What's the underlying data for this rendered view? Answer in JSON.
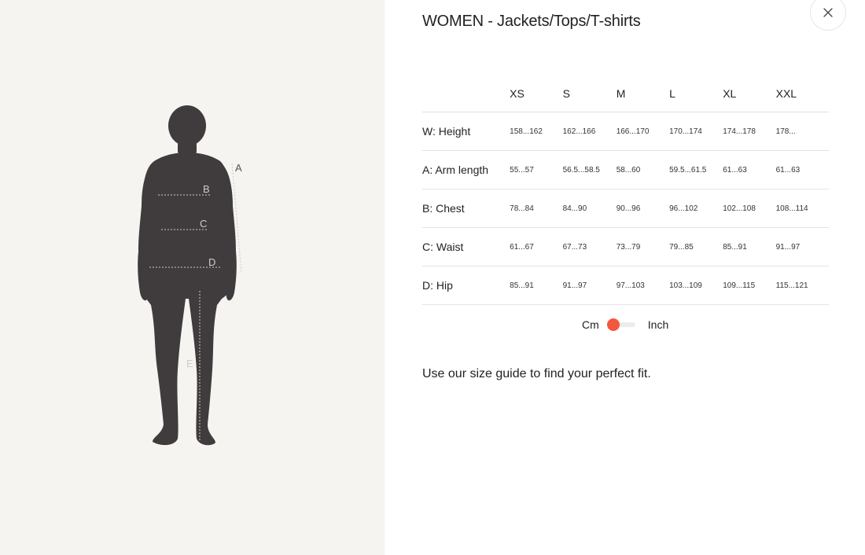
{
  "figure": {
    "labels": {
      "a": "A",
      "b": "B",
      "c": "C",
      "d": "D",
      "e": "E"
    },
    "silhouette_color": "#403b3c",
    "background_color": "#f5f4f0"
  },
  "header": {
    "title": "WOMEN - Jackets/Tops/T-shirts",
    "close_icon": "×"
  },
  "table": {
    "sizes": [
      "XS",
      "S",
      "M",
      "L",
      "XL",
      "XXL"
    ],
    "rows": [
      {
        "label": "W: Height",
        "values": [
          "158...162",
          "162...166",
          "166...170",
          "170...174",
          "174...178",
          "178..."
        ]
      },
      {
        "label": "A: Arm length",
        "values": [
          "55...57",
          "56.5...58.5",
          "58...60",
          "59.5...61.5",
          "61...63",
          "61...63"
        ]
      },
      {
        "label": "B: Chest",
        "values": [
          "78...84",
          "84...90",
          "90...96",
          "96...102",
          "102...108",
          "108...114"
        ]
      },
      {
        "label": "C: Waist",
        "values": [
          "61...67",
          "67...73",
          "73...79",
          "79...85",
          "85...91",
          "91...97"
        ]
      },
      {
        "label": "D: Hip",
        "values": [
          "85...91",
          "91...97",
          "97...103",
          "103...109",
          "109...115",
          "115...121"
        ]
      }
    ]
  },
  "unit_toggle": {
    "left_label": "Cm",
    "right_label": "Inch",
    "selected": "Cm",
    "accent_color": "#f4573d"
  },
  "guide_text": "Use our size guide to find your perfect fit."
}
